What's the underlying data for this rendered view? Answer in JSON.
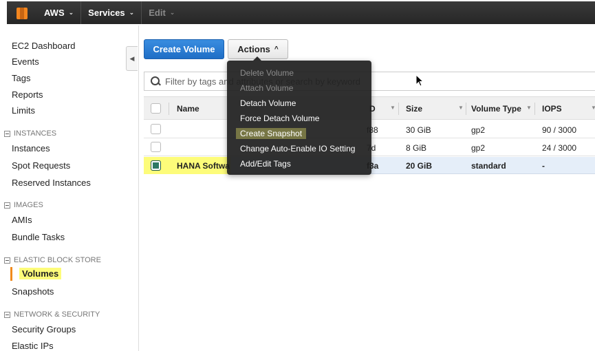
{
  "topnav": {
    "brand": "AWS",
    "services": "Services",
    "edit": "Edit",
    "chevron": "⌄"
  },
  "sidebar": {
    "collapse_arrow": "◀",
    "top_links": [
      "EC2 Dashboard",
      "Events",
      "Tags",
      "Reports",
      "Limits"
    ],
    "sections": [
      {
        "title": "INSTANCES",
        "items": [
          "Instances",
          "Spot Requests",
          "Reserved Instances"
        ]
      },
      {
        "title": "IMAGES",
        "items": [
          "AMIs",
          "Bundle Tasks"
        ]
      },
      {
        "title": "ELASTIC BLOCK STORE",
        "items": [
          "Volumes",
          "Snapshots"
        ],
        "active": "Volumes"
      },
      {
        "title": "NETWORK & SECURITY",
        "items": [
          "Security Groups",
          "Elastic IPs"
        ]
      }
    ]
  },
  "toolbar": {
    "create_label": "Create Volume",
    "actions_label": "Actions",
    "actions_caret": "^"
  },
  "filter": {
    "placeholder": "Filter by tags and attributes or search by keyword"
  },
  "table": {
    "headers": [
      "Name",
      "D",
      "Size",
      "Volume Type",
      "IOPS"
    ],
    "rows": [
      {
        "name": "",
        "id_suffix": "f88",
        "size": "30 GiB",
        "type": "gp2",
        "iops": "90 / 3000",
        "selected": false
      },
      {
        "name": "",
        "id_suffix": "7d",
        "size": "8 GiB",
        "type": "gp2",
        "iops": "24 / 3000",
        "selected": false
      },
      {
        "name": "HANA Softwa",
        "id_suffix": "f3a",
        "size": "20 GiB",
        "type": "standard",
        "iops": "-",
        "selected": true
      }
    ]
  },
  "actions_menu": {
    "items": [
      {
        "label": "Delete Volume",
        "enabled": false
      },
      {
        "label": "Attach Volume",
        "enabled": false
      },
      {
        "label": "Detach Volume",
        "enabled": true
      },
      {
        "label": "Force Detach Volume",
        "enabled": true
      },
      {
        "label": "Create Snapshot",
        "enabled": true,
        "highlighted": true
      },
      {
        "label": "Change Auto-Enable IO Setting",
        "enabled": true
      },
      {
        "label": "Add/Edit Tags",
        "enabled": true
      }
    ]
  },
  "colors": {
    "accent_orange": "#f08a1c",
    "highlight_yellow": "#fdfc7a",
    "primary_blue": "#2b7fd6"
  }
}
